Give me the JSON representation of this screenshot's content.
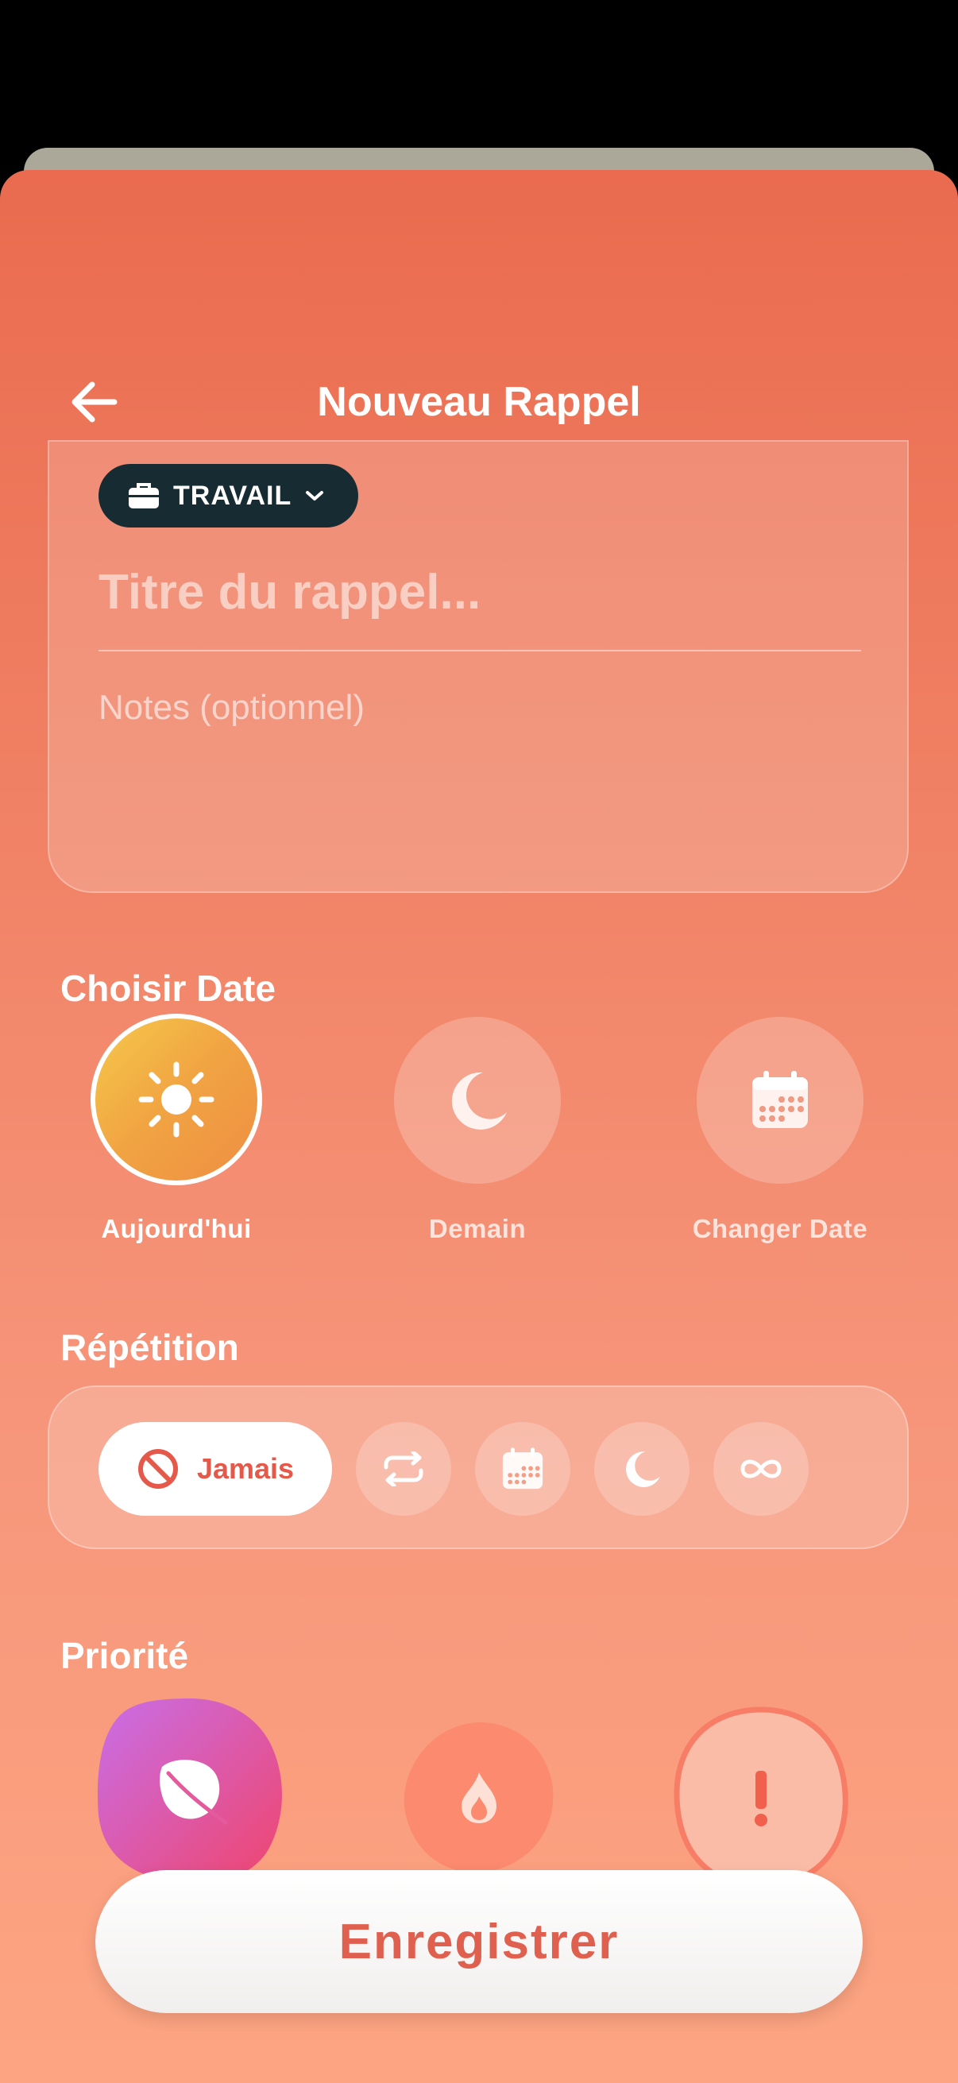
{
  "header": {
    "title": "Nouveau Rappel"
  },
  "reminder": {
    "category": "TRAVAIL",
    "title_placeholder": "Titre du rappel...",
    "notes_placeholder": "Notes (optionnel)"
  },
  "date": {
    "section_title": "Choisir Date",
    "options": [
      {
        "label": "Aujourd'hui",
        "icon": "sun-icon",
        "selected": true
      },
      {
        "label": "Demain",
        "icon": "moon-icon",
        "selected": false
      },
      {
        "label": "Changer Date",
        "icon": "calendar-icon",
        "selected": false
      }
    ]
  },
  "repeat": {
    "section_title": "Répétition",
    "selected_label": "Jamais",
    "options": [
      "never-icon",
      "repeat-icon",
      "calendar-icon",
      "moon-icon",
      "infinity-icon"
    ]
  },
  "priority": {
    "section_title": "Priorité",
    "options": [
      "leaf-icon",
      "flame-icon",
      "exclamation-icon"
    ]
  },
  "save_label": "Enregistrer",
  "colors": {
    "accent": "#e5594a",
    "category_bg": "#172b33",
    "sun": "#f5c84a"
  }
}
